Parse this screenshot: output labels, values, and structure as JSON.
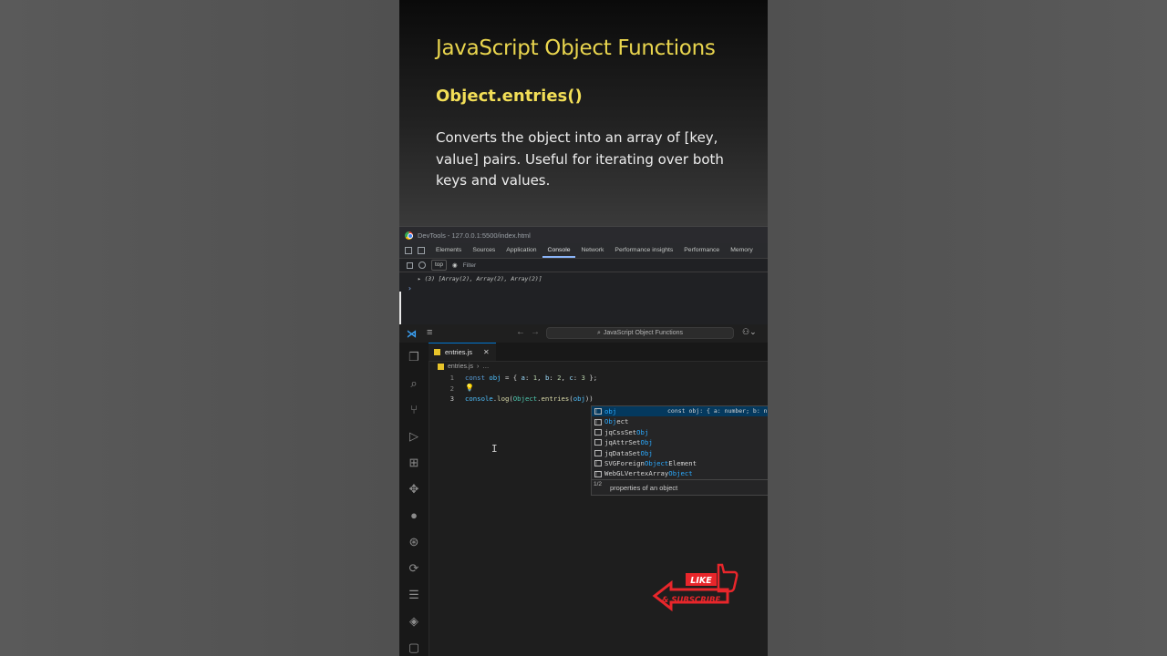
{
  "card": {
    "title": "JavaScript Object Functions",
    "subtitle": "Object.entries()",
    "description": "Converts the object into an array of [key, value] pairs. Useful for iterating over both keys and values."
  },
  "devtools": {
    "window_title": "DevTools - 127.0.0.1:5500/index.html",
    "tabs": [
      "Elements",
      "Sources",
      "Application",
      "Console",
      "Network",
      "Performance insights",
      "Performance",
      "Memory"
    ],
    "active_tab": "Console",
    "context": "top",
    "filter_placeholder": "Filter",
    "output": "(3) [Array(2), Array(2), Array(2)]",
    "prompt": "›"
  },
  "vscode": {
    "search_text": "JavaScript Object Functions",
    "tab_label": "entries.js",
    "breadcrumb_file": "entries.js",
    "breadcrumb_more": "…",
    "line_numbers": [
      "1",
      "2",
      "3"
    ],
    "suggestions": [
      {
        "prefix": "",
        "match": "obj",
        "suffix": "",
        "kind": "variable",
        "detail": "const obj: { a: number; b: n"
      },
      {
        "prefix": "",
        "match": "Obj",
        "suffix": "ect",
        "kind": "variable",
        "detail": ""
      },
      {
        "prefix": "jqCssSet",
        "match": "Obj",
        "suffix": "",
        "kind": "square",
        "detail": ""
      },
      {
        "prefix": "jqAttrSet",
        "match": "Obj",
        "suffix": "",
        "kind": "square",
        "detail": ""
      },
      {
        "prefix": "jqDataSet",
        "match": "Obj",
        "suffix": "",
        "kind": "square",
        "detail": ""
      },
      {
        "prefix": "SVGForeign",
        "match": "Object",
        "suffix": "Element",
        "kind": "variable",
        "detail": ""
      },
      {
        "prefix": "WebGLVertexArray",
        "match": "Object",
        "suffix": "",
        "kind": "variable",
        "detail": ""
      }
    ],
    "suggest_count": "1/2",
    "suggest_doc": "properties of an object"
  },
  "overlay": {
    "like": "LIKE",
    "subscribe": "& SUBSCRIBE",
    "accent_color": "#e8262b"
  }
}
